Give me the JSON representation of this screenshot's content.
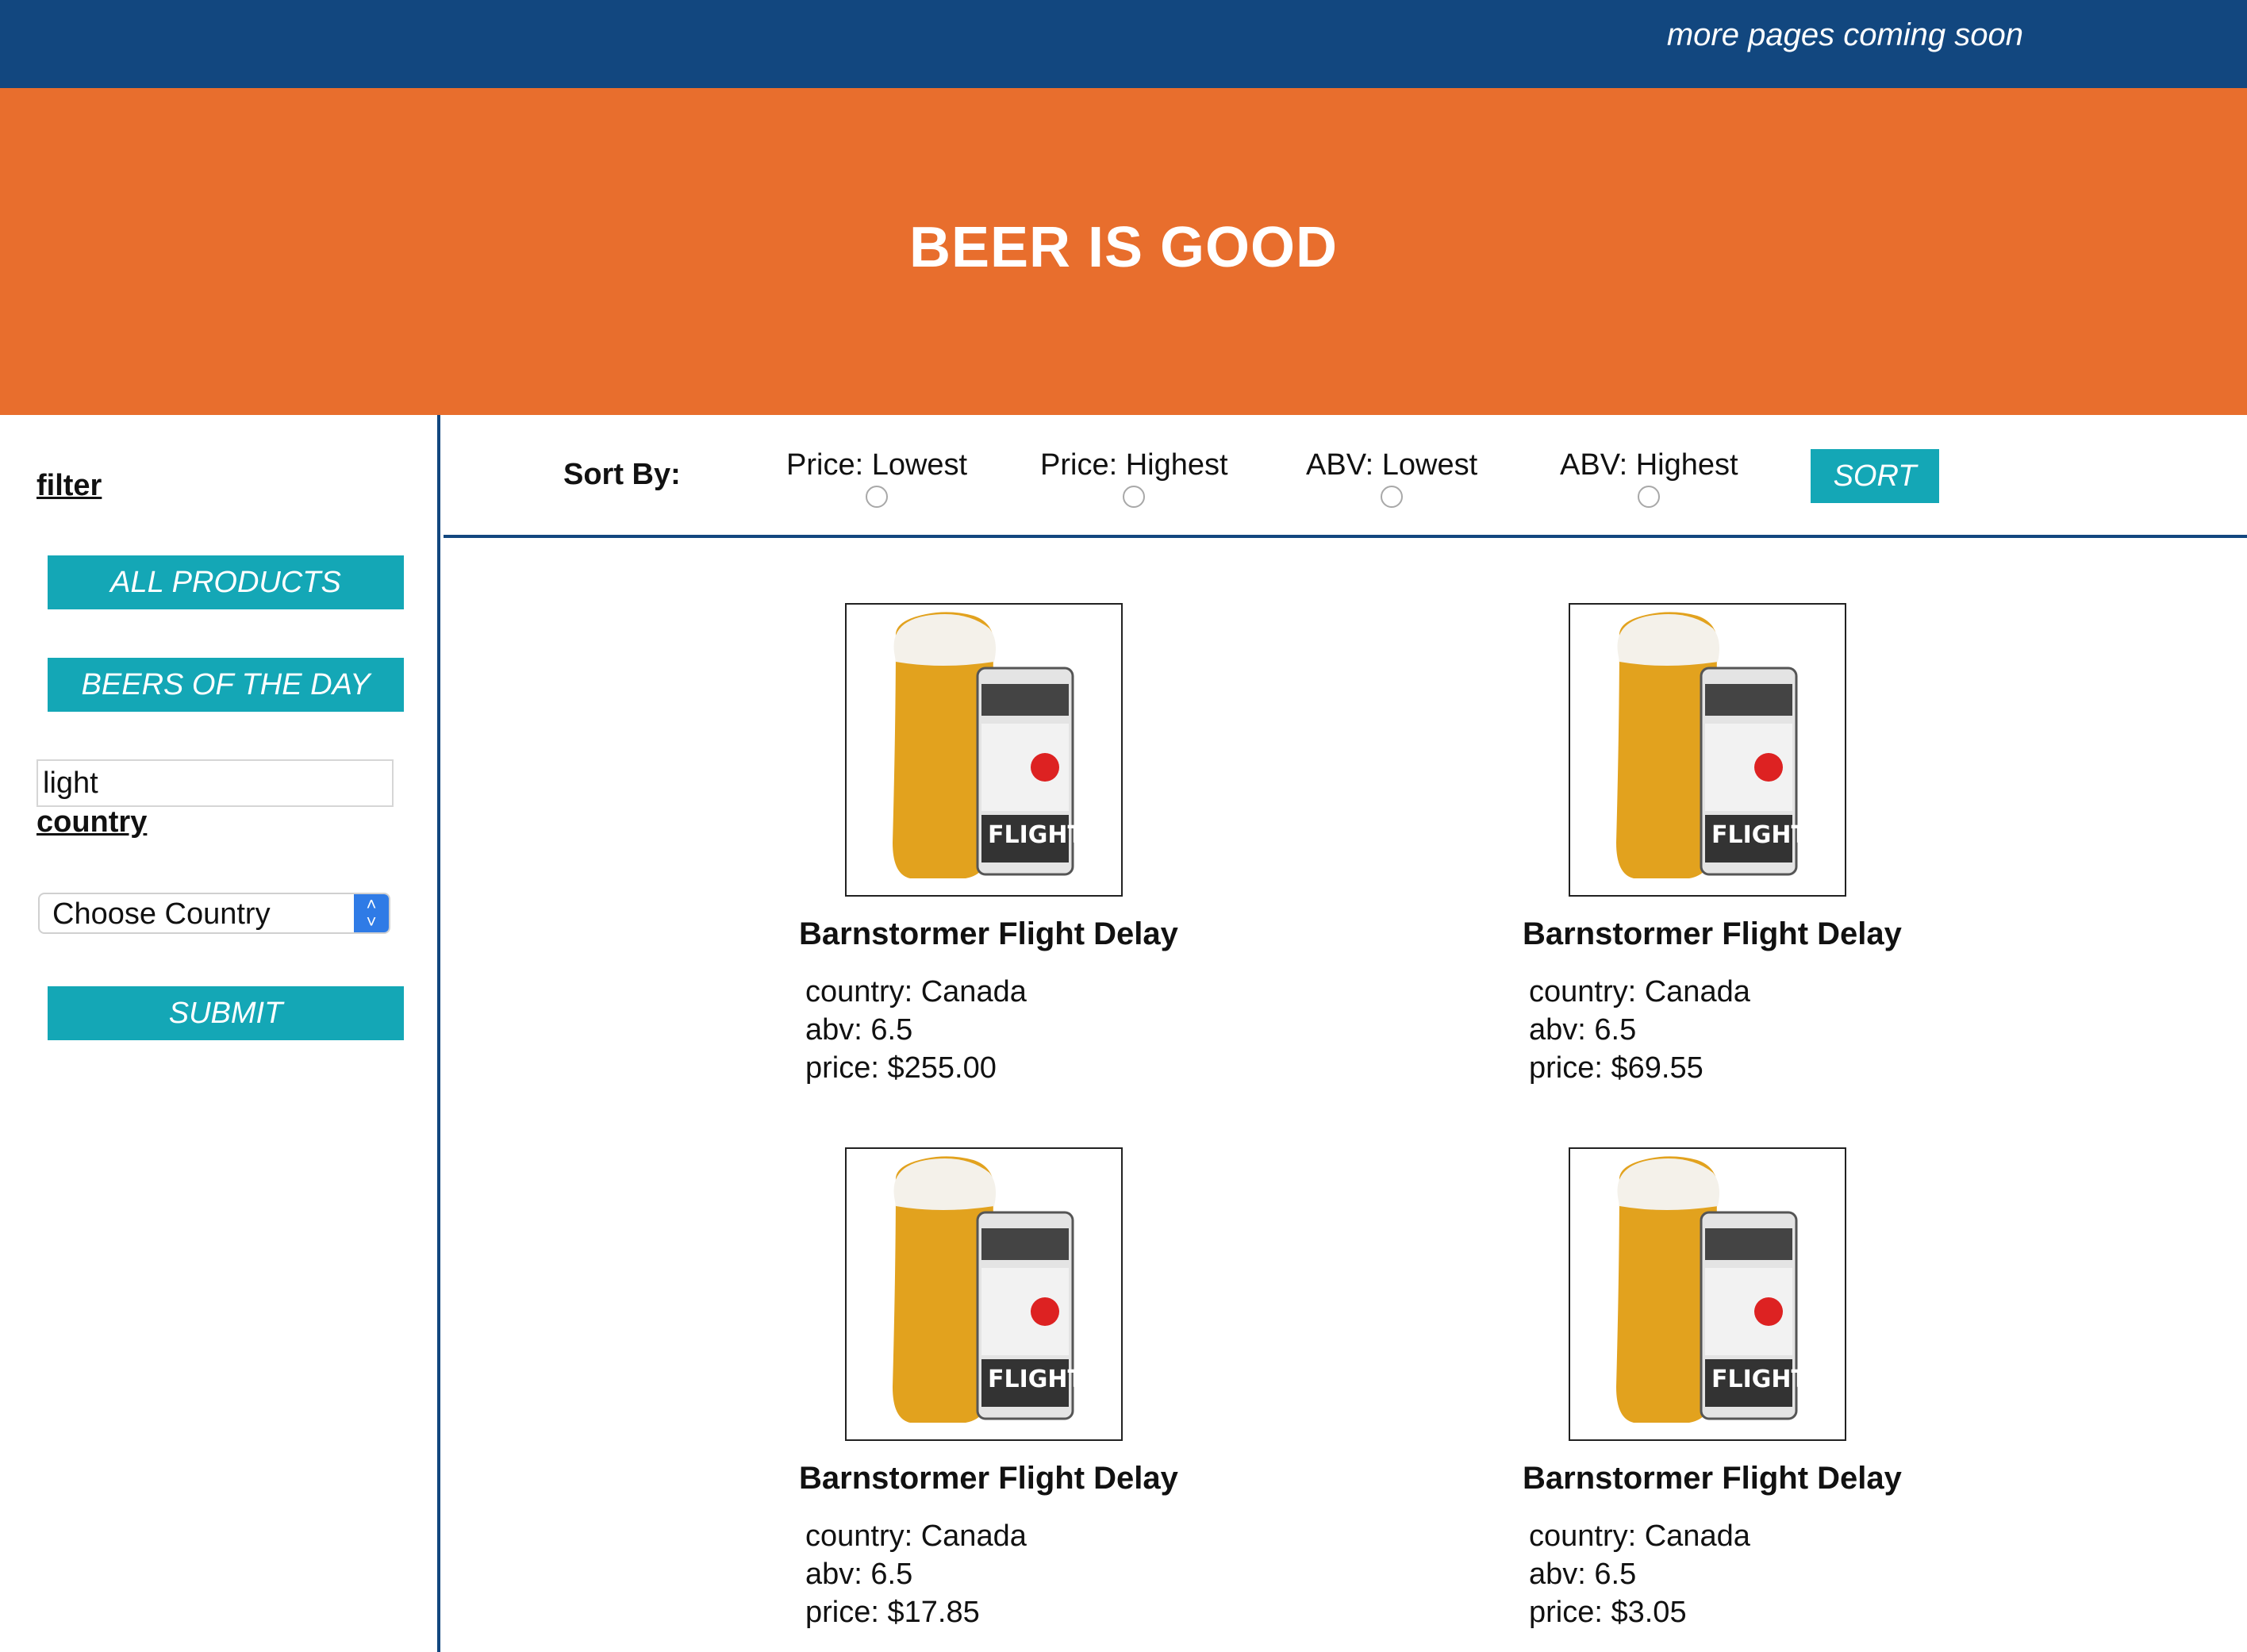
{
  "topbar": {
    "notice": "more pages coming soon"
  },
  "hero": {
    "title": "BEER IS GOOD"
  },
  "sidebar": {
    "filter_label": "filter",
    "all_products_label": "ALL PRODUCTS",
    "beers_of_day_label": "BEERS OF THE DAY",
    "search_value": "light",
    "country_label": "country",
    "country_select_value": "Choose Country",
    "submit_label": "SUBMIT"
  },
  "sort": {
    "label": "Sort By:",
    "options": [
      "Price: Lowest",
      "Price: Highest",
      "ABV: Lowest",
      "ABV: Highest"
    ],
    "button_label": "SORT"
  },
  "products": [
    {
      "name": "Barnstormer Flight Delay",
      "country": "country: Canada",
      "abv": "abv: 6.5",
      "price": "price: $255.00"
    },
    {
      "name": "Barnstormer Flight Delay",
      "country": "country: Canada",
      "abv": "abv: 6.5",
      "price": "price: $69.55"
    },
    {
      "name": "Barnstormer Flight Delay",
      "country": "country: Canada",
      "abv": "abv: 6.5",
      "price": "price: $17.85"
    },
    {
      "name": "Barnstormer Flight Delay",
      "country": "country: Canada",
      "abv": "abv: 6.5",
      "price": "price: $3.05"
    }
  ],
  "colors": {
    "topbar": "#12477f",
    "hero": "#e86e2d",
    "button": "#14a7b6"
  }
}
